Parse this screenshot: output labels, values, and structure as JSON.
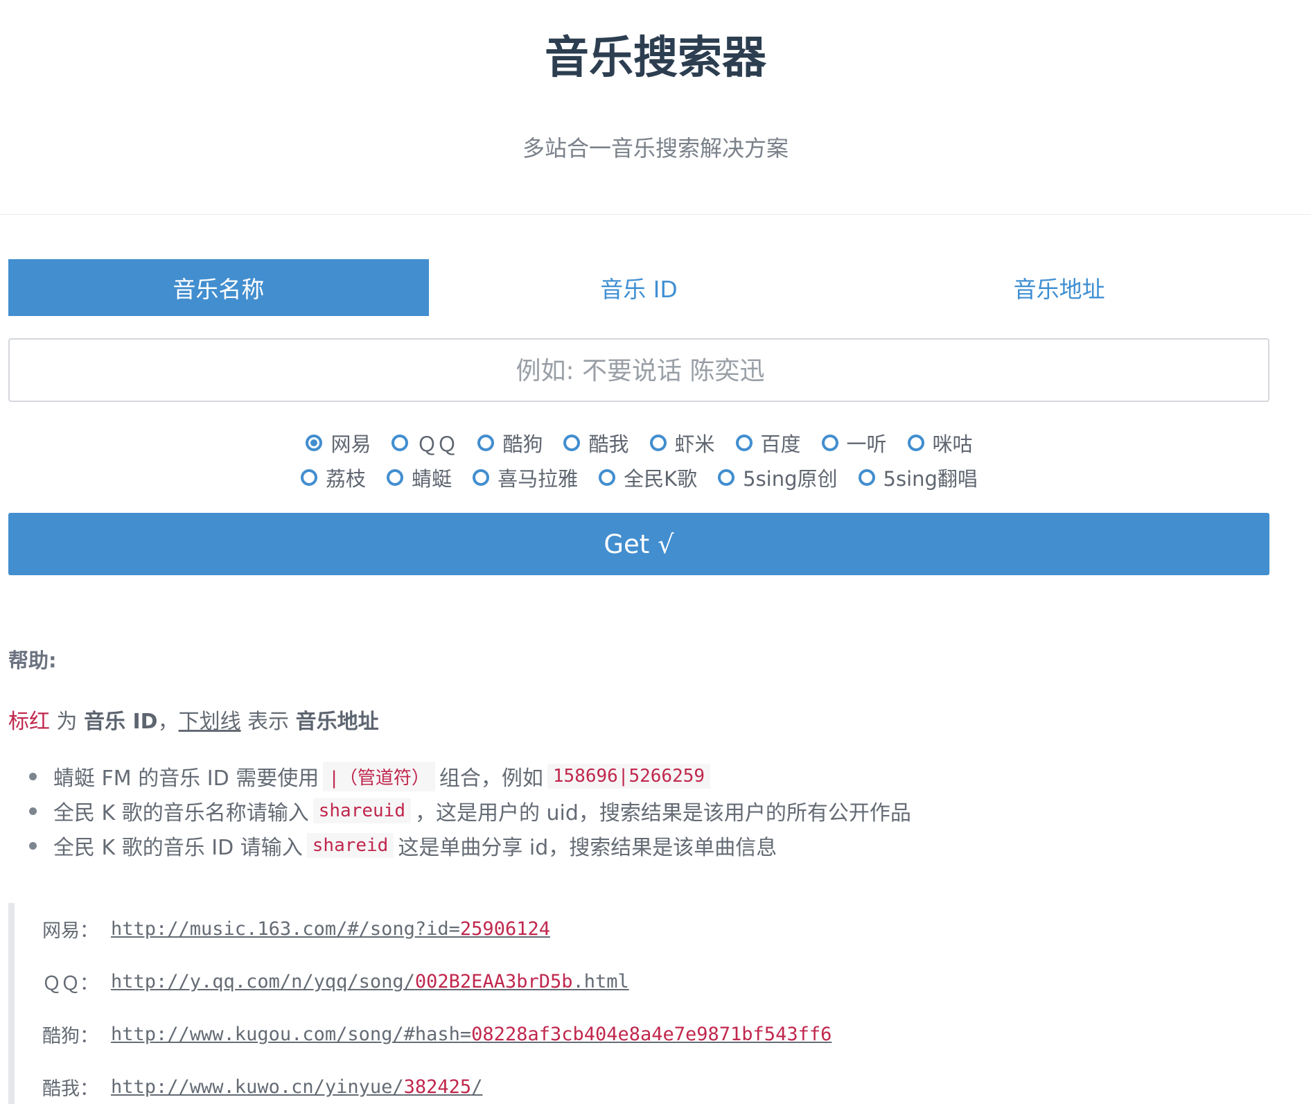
{
  "header": {
    "title": "音乐搜索器",
    "subtitle": "多站合一音乐搜索解决方案"
  },
  "tabs": [
    {
      "label": "音乐名称",
      "active": true
    },
    {
      "label": "音乐 ID",
      "active": false
    },
    {
      "label": "音乐地址",
      "active": false
    }
  ],
  "search": {
    "placeholder": "例如: 不要说话 陈奕迅",
    "value": ""
  },
  "sources": {
    "selected": "网易",
    "row1": [
      "网易",
      "ＱＱ",
      "酷狗",
      "酷我",
      "虾米",
      "百度",
      "一听",
      "咪咕"
    ],
    "row2": [
      "荔枝",
      "蜻蜓",
      "喜马拉雅",
      "全民K歌",
      "5sing原创",
      "5sing翻唱"
    ]
  },
  "get_button": {
    "label": "Get √"
  },
  "help": {
    "title": "帮助:",
    "legend_red": "标红",
    "legend_for": " 为 ",
    "legend_id": "音乐 ID",
    "legend_comma": "，",
    "legend_underline": "下划线",
    "legend_means": " 表示 ",
    "legend_url": "音乐地址",
    "items": [
      {
        "before": "蜻蜓 FM 的音乐 ID 需要使用 ",
        "code": "|（管道符）",
        "after": " 组合，例如 ",
        "code2": "158696|5266259"
      },
      {
        "before": "全民 K 歌的音乐名称请输入 ",
        "code": "shareuid",
        "after": "，这是用户的 uid，搜索结果是该用户的所有公开作品"
      },
      {
        "before": "全民 K 歌的音乐 ID 请输入 ",
        "code": "shareid",
        "after": " 这是单曲分享 id，搜索结果是该单曲信息"
      }
    ]
  },
  "examples": [
    {
      "label": "网易：",
      "prefix": "http://music.163.com/#/song?id=",
      "id": "25906124",
      "suffix": ""
    },
    {
      "label": "ＱＱ：",
      "prefix": "http://y.qq.com/n/yqq/song/",
      "id": "002B2EAA3brD5b",
      "suffix": ".html"
    },
    {
      "label": "酷狗：",
      "prefix": "http://www.kugou.com/song/#hash=",
      "id": "08228af3cb404e8a4e7e9871bf543ff6",
      "suffix": ""
    },
    {
      "label": "酷我：",
      "prefix": "http://www.kuwo.cn/yinyue/",
      "id": "382425",
      "suffix": "/"
    }
  ],
  "colors": {
    "primary": "#428ecf",
    "title": "#2c3e50",
    "highlight_red": "#c0274d"
  }
}
